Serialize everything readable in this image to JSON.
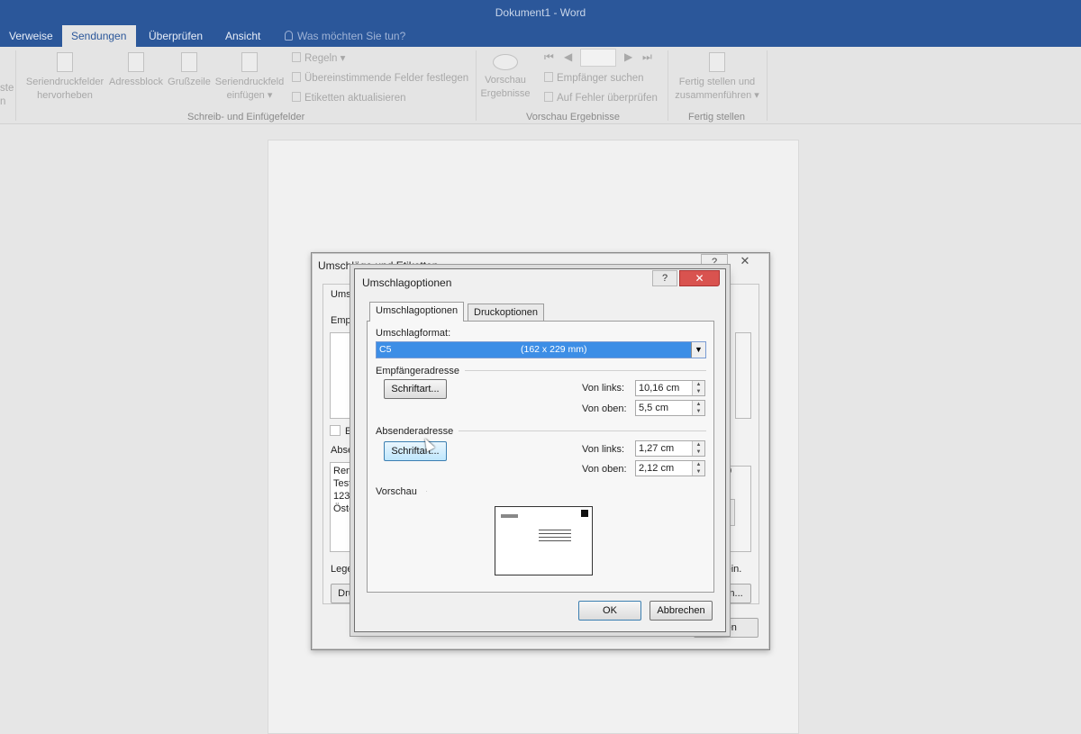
{
  "window": {
    "title": "Dokument1 - Word"
  },
  "ribbon_tabs": [
    {
      "label": "Verweise"
    },
    {
      "label": "Sendungen",
      "active": true
    },
    {
      "label": "Überprüfen"
    },
    {
      "label": "Ansicht"
    }
  ],
  "tell_me": "Was möchten Sie tun?",
  "ribbon": {
    "cut_left_label_1": "ste",
    "cut_left_label_2": "n",
    "btn_highlight_1": "Seriendruckfelder",
    "btn_highlight_2": "hervorheben",
    "btn_address": "Adressblock",
    "btn_greeting": "Grußzeile",
    "btn_insert_field_1": "Seriendruckfeld",
    "btn_insert_field_2": "einfügen",
    "rules": "Regeln",
    "match_fields": "Übereinstimmende Felder festlegen",
    "update_labels": "Etiketten aktualisieren",
    "group_write": "Schreib- und Einfügefelder",
    "preview_1": "Vorschau",
    "preview_2": "Ergebnisse",
    "find_recipient": "Empfänger suchen",
    "check_errors": "Auf Fehler überprüfen",
    "group_preview": "Vorschau Ergebnisse",
    "finish_1": "Fertig stellen und",
    "finish_2": "zusammenführen",
    "group_finish": "Fertig stellen"
  },
  "bg_dialog": {
    "title": "Umschläge und Etiketten",
    "help": "?",
    "close": "✕",
    "frag_tab": "Umsc",
    "frag_recipient": "Empf",
    "frag_el": "El",
    "frag_sender": "Abse",
    "sender_lines": [
      "Rene",
      "Tests",
      "1230",
      "Öste"
    ],
    "frag_lege": "Lege",
    "frag_right": "st ein.",
    "frag_dru": "Dru",
    "frag_en": "en...",
    "frag_chen": "chen",
    "frag_digit": "0"
  },
  "dialog": {
    "title": "Umschlagoptionen",
    "help": "?",
    "close": "✕",
    "tabs": [
      {
        "label": "Umschlagoptionen",
        "active": true
      },
      {
        "label": "Druckoptionen"
      }
    ],
    "format_label": "Umschlagformat:",
    "format_value": "C5",
    "format_dims": "(162 x 229 mm)",
    "recipient_section": "Empfängeradresse",
    "recipient_font_btn": "Schriftart...",
    "recipient_left_label": "Von links:",
    "recipient_left_value": "10,16 cm",
    "recipient_top_label": "Von oben:",
    "recipient_top_value": "5,5 cm",
    "sender_section": "Absenderadresse",
    "sender_font_btn": "Schriftart...",
    "sender_left_label": "Von links:",
    "sender_left_value": "1,27 cm",
    "sender_top_label": "Von oben:",
    "sender_top_value": "2,12 cm",
    "preview_section": "Vorschau",
    "ok": "OK",
    "cancel": "Abbrechen"
  }
}
